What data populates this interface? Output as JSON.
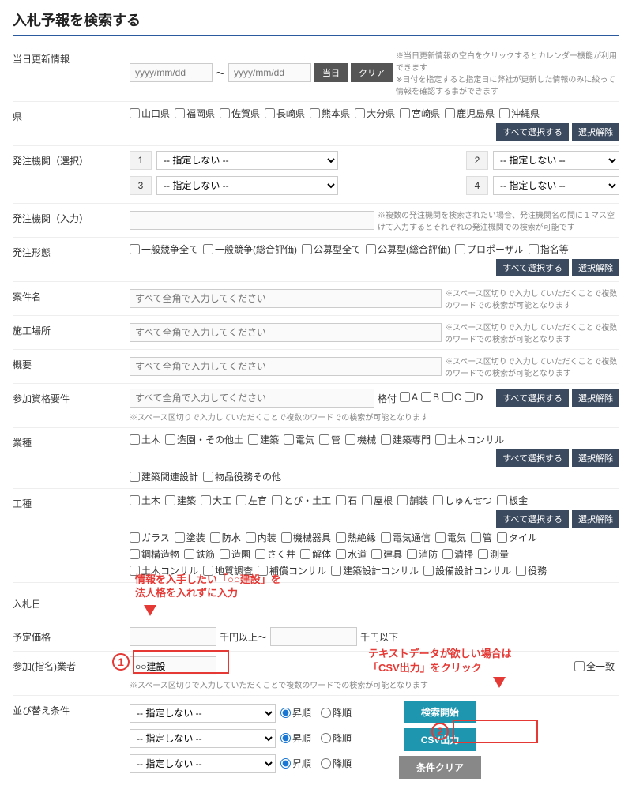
{
  "title": "入札予報を検索する",
  "update": {
    "label": "当日更新情報",
    "placeholder": "yyyy/mm/dd",
    "tilde": "～",
    "btn_today": "当日",
    "btn_clear": "クリア",
    "hint": "※当日更新情報の空白をクリックするとカレンダー機能が利用できます\n※日付を指定すると指定日に弊社が更新した情報のみに絞って情報を確認する事ができます"
  },
  "prefecture": {
    "label": "県",
    "items": [
      "山口県",
      "福岡県",
      "佐賀県",
      "長崎県",
      "熊本県",
      "大分県",
      "宮崎県",
      "鹿児島県",
      "沖縄県"
    ],
    "btn_all": "すべて選択する",
    "btn_clear": "選択解除"
  },
  "agency_select": {
    "label": "発注機関（選択）",
    "default": "-- 指定しない --",
    "nums": [
      "1",
      "2",
      "3",
      "4"
    ]
  },
  "agency_input": {
    "label": "発注機関（入力）",
    "hint": "※複数の発注機関を検索されたい場合、発注機関名の間に１マス空けて入力するとそれぞれの発注機関での検索が可能です"
  },
  "order_type": {
    "label": "発注形態",
    "items": [
      "一般競争全て",
      "一般競争(総合評価)",
      "公募型全て",
      "公募型(総合評価)",
      "プロポーザル",
      "指名等"
    ],
    "btn_all": "すべて選択する",
    "btn_clear": "選択解除"
  },
  "case_name": {
    "label": "案件名",
    "placeholder": "すべて全角で入力してください",
    "hint": "※スペース区切りで入力していただくことで複数のワードでの検索が可能となります"
  },
  "site": {
    "label": "施工場所",
    "placeholder": "すべて全角で入力してください",
    "hint": "※スペース区切りで入力していただくことで複数のワードでの検索が可能となります"
  },
  "summary": {
    "label": "概要",
    "placeholder": "すべて全角で入力してください",
    "hint": "※スペース区切りで入力していただくことで複数のワードでの検索が可能となります"
  },
  "qualification": {
    "label": "参加資格要件",
    "placeholder": "すべて全角で入力してください",
    "grade_label": "格付",
    "grades": [
      "A",
      "B",
      "C",
      "D"
    ],
    "btn_all": "すべて選択する",
    "btn_clear": "選択解除",
    "hint": "※スペース区切りで入力していただくことで複数のワードでの検索が可能となります"
  },
  "industry": {
    "label": "業種",
    "line1": [
      "土木",
      "造園・その他土",
      "建築",
      "電気",
      "管",
      "機械",
      "建築専門",
      "土木コンサル"
    ],
    "line2": [
      "建築関連設計",
      "物品役務その他"
    ],
    "btn_all": "すべて選択する",
    "btn_clear": "選択解除"
  },
  "work_type": {
    "label": "工種",
    "line1": [
      "土木",
      "建築",
      "大工",
      "左官",
      "とび・土工",
      "石",
      "屋根",
      "舗装",
      "しゅんせつ",
      "板金"
    ],
    "line2": [
      "ガラス",
      "塗装",
      "防水",
      "内装",
      "機械器具",
      "熱絶縁",
      "電気通信",
      "電気",
      "管",
      "タイル"
    ],
    "line3": [
      "鋼構造物",
      "鉄筋",
      "造園",
      "さく井",
      "解体",
      "水道",
      "建具",
      "消防",
      "清掃",
      "測量"
    ],
    "line4": [
      "土木コンサル",
      "地質調査",
      "補償コンサル",
      "建築設計コンサル",
      "設備設計コンサル",
      "役務"
    ],
    "btn_all": "すべて選択する",
    "btn_clear": "選択解除"
  },
  "bid_date": {
    "label": "入札日"
  },
  "planned_price": {
    "label": "予定価格",
    "unit_from": "千円以上～",
    "unit_to": "千円以下"
  },
  "participant": {
    "label": "参加(指名)業者",
    "value": "○○建設",
    "match_label": "全一致",
    "hint": "※スペース区切りで入力していただくことで複数のワードでの検索が可能となります"
  },
  "sort": {
    "label": "並び替え条件",
    "default": "-- 指定しない --",
    "asc": "昇順",
    "desc": "降順"
  },
  "actions": {
    "search": "検索開始",
    "csv": "CSV出力",
    "clear": "条件クリア"
  },
  "annotations": {
    "top": "情報を入手したい「○○建設」を\n法人格を入れずに入力",
    "right": "テキストデータが欲しい場合は\n「CSV出力」をクリック",
    "num1": "1",
    "num2": "2"
  }
}
